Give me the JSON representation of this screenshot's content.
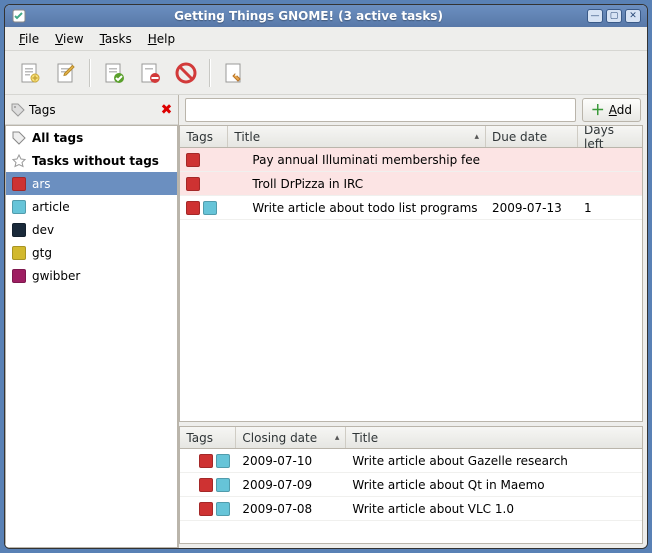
{
  "window": {
    "title": "Getting Things GNOME! (3 active tasks)"
  },
  "menubar": {
    "file": "File",
    "view": "View",
    "tasks": "Tasks",
    "help": "Help"
  },
  "sidebar": {
    "header": "Tags",
    "all_tags": "All tags",
    "no_tags": "Tasks without tags",
    "tags": [
      {
        "name": "ars",
        "color": "#ce3232",
        "selected": true
      },
      {
        "name": "article",
        "color": "#66c4d8"
      },
      {
        "name": "dev",
        "color": "#1a2a3a"
      },
      {
        "name": "gtg",
        "color": "#d2b92e"
      },
      {
        "name": "gwibber",
        "color": "#9e1e62"
      }
    ]
  },
  "search": {
    "placeholder": "",
    "add_label": "Add"
  },
  "tasks": {
    "columns": {
      "tags": "Tags",
      "title": "Title",
      "due": "Due date",
      "days_left": "Days left"
    },
    "rows": [
      {
        "tags": [
          "#ce3232"
        ],
        "title": "Pay annual Illuminati membership fee",
        "due": "",
        "days_left": "",
        "overdue": true
      },
      {
        "tags": [
          "#ce3232"
        ],
        "title": "Troll DrPizza in IRC",
        "due": "",
        "days_left": "",
        "overdue": true
      },
      {
        "tags": [
          "#ce3232",
          "#66c4d8"
        ],
        "title": "Write article about todo list programs",
        "due": "2009-07-13",
        "days_left": "1",
        "overdue": false
      }
    ]
  },
  "closed": {
    "columns": {
      "tags": "Tags",
      "closing": "Closing date",
      "title": "Title"
    },
    "rows": [
      {
        "tags": [
          "#ce3232",
          "#66c4d8"
        ],
        "date": "2009-07-10",
        "title": "Write article about Gazelle research"
      },
      {
        "tags": [
          "#ce3232",
          "#66c4d8"
        ],
        "date": "2009-07-09",
        "title": "Write article about Qt in Maemo"
      },
      {
        "tags": [
          "#ce3232",
          "#66c4d8"
        ],
        "date": "2009-07-08",
        "title": "Write article about VLC 1.0"
      }
    ]
  }
}
